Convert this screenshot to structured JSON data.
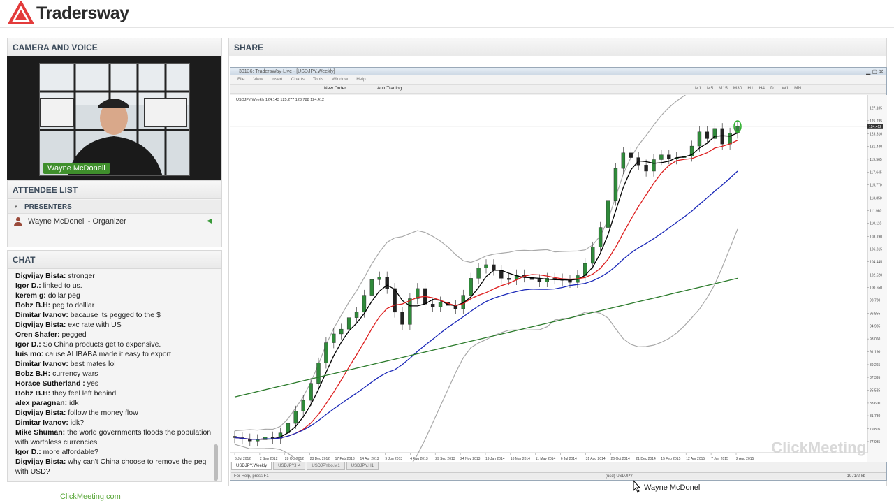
{
  "brand": {
    "logo_text": "Tradersway"
  },
  "camera_panel": {
    "title": "CAMERA AND VOICE",
    "presenter_name": "Wayne McDonell"
  },
  "attendee_panel": {
    "title": "ATTENDEE LIST",
    "group_label": "PRESENTERS",
    "presenter": "Wayne McDonell - Organizer"
  },
  "chat_panel": {
    "title": "CHAT",
    "messages": [
      {
        "name": "Digvijay Bista:",
        "text": " stronger"
      },
      {
        "name": "Igor D.:",
        "text": " linked to us."
      },
      {
        "name": "kerem g:",
        "text": " dollar peg"
      },
      {
        "name": "Bobz B.H:",
        "text": " peg to dolllar"
      },
      {
        "name": "Dimitar Ivanov:",
        "text": " bacause its pegged to the $"
      },
      {
        "name": "Digvijay Bista:",
        "text": " exc rate with US"
      },
      {
        "name": "Oren Shafer:",
        "text": " pegged"
      },
      {
        "name": "Igor D.:",
        "text": " So China products get to expensive."
      },
      {
        "name": "luis mo:",
        "text": " cause ALIBABA made it easy to export"
      },
      {
        "name": "Dimitar Ivanov:",
        "text": " best mates lol"
      },
      {
        "name": "Bobz B.H:",
        "text": " currency wars"
      },
      {
        "name": "Horace Sutherland :",
        "text": " yes"
      },
      {
        "name": "Bobz B.H:",
        "text": " they feel left behind"
      },
      {
        "name": "alex paragnan:",
        "text": " idk"
      },
      {
        "name": "Digvijay Bista:",
        "text": " follow the money flow"
      },
      {
        "name": "Dimitar Ivanov:",
        "text": " idk?"
      },
      {
        "name": "Mike Shuman:",
        "text": " the world governments floods the population with worthless currencies"
      },
      {
        "name": "Igor D.:",
        "text": " more affordable?"
      },
      {
        "name": "Digvijay Bista:",
        "text": " why can't China choose to remove the peg with USD?"
      }
    ]
  },
  "footer": {
    "clickmeeting": "ClickMeeting.com",
    "cursor_label": "Wayne McDonell",
    "watermark": "ClickMeeting"
  },
  "share_panel": {
    "title": "SHARE",
    "window_title": "30136: TradersWay-Live - [USDJPY,Weekly]",
    "menu": [
      "File",
      "View",
      "Insert",
      "Charts",
      "Tools",
      "Window",
      "Help"
    ],
    "toolbar": {
      "new_order": "New Order",
      "autotrading": "AutoTrading"
    },
    "timeframes": [
      "M1",
      "M5",
      "M15",
      "M30",
      "H1",
      "H4",
      "D1",
      "W1",
      "MN"
    ],
    "chart_info": "USDJPY,Weekly  124.143 125.277 123.788 124.412",
    "tabs": [
      "USDJPY,Weekly",
      "USDJPY,H4",
      "USDJPYbo,M1",
      "USDJPY,H1"
    ],
    "status_left": "For Help, press F1",
    "status_mid": "(usd) USDJPY",
    "status_right": "1971/2 kb"
  },
  "chart_data": {
    "type": "candlestick",
    "symbol": "USDJPY",
    "timeframe": "Weekly",
    "x_tick_labels": [
      "6 Jul 2012",
      "2 Sep 2012",
      "28 Oct 2012",
      "23 Dec 2012",
      "17 Feb 2013",
      "14 Apr 2013",
      "9 Jun 2013",
      "4 Aug 2013",
      "29 Sep 2013",
      "24 Nov 2013",
      "19 Jan 2014",
      "16 Mar 2014",
      "11 May 2014",
      "6 Jul 2014",
      "31 Aug 2014",
      "26 Oct 2014",
      "21 Dec 2014",
      "15 Feb 2015",
      "12 Apr 2015",
      "7 Jun 2015",
      "2 Aug 2015"
    ],
    "y_tick_labels": [
      "127.105",
      "125.235",
      "123.310",
      "121.440",
      "119.565",
      "117.645",
      "115.770",
      "113.850",
      "111.980",
      "110.110",
      "108.190",
      "106.315",
      "104.445",
      "102.520",
      "100.650",
      "98.780",
      "96.855",
      "94.985",
      "93.060",
      "91.190",
      "89.265",
      "87.395",
      "85.525",
      "83.600",
      "81.730",
      "79.805",
      "77.935"
    ],
    "current_price": "124.412",
    "ylim": [
      77.0,
      128.0
    ],
    "close_series": [
      78.5,
      78.3,
      78.0,
      78.2,
      78.6,
      78.4,
      79.2,
      80.6,
      82.4,
      84.0,
      86.5,
      89.5,
      92.5,
      93.8,
      94.5,
      96.2,
      97.0,
      99.5,
      101.8,
      102.2,
      100.5,
      97.0,
      95.2,
      99.0,
      100.5,
      98.2,
      97.8,
      98.5,
      98.0,
      97.5,
      99.5,
      102.0,
      103.5,
      104.0,
      103.2,
      102.0,
      101.8,
      102.5,
      102.2,
      101.8,
      101.5,
      102.0,
      101.9,
      101.7,
      101.4,
      102.4,
      104.2,
      106.6,
      109.5,
      113.5,
      118.2,
      120.5,
      119.8,
      118.7,
      117.8,
      119.5,
      120.2,
      119.6,
      119.8,
      120.0,
      121.5,
      123.6,
      122.6,
      124.1,
      121.8,
      123.4,
      124.4
    ],
    "indicators": [
      {
        "type": "SMA",
        "color": "#000000"
      },
      {
        "type": "SMA",
        "color": "#dd1f1f"
      },
      {
        "type": "SMA",
        "color": "#1a28b8"
      },
      {
        "type": "SMA",
        "color": "#2a7a2a"
      },
      {
        "type": "Bollinger Bands",
        "color": "#a9a9a9"
      }
    ]
  }
}
